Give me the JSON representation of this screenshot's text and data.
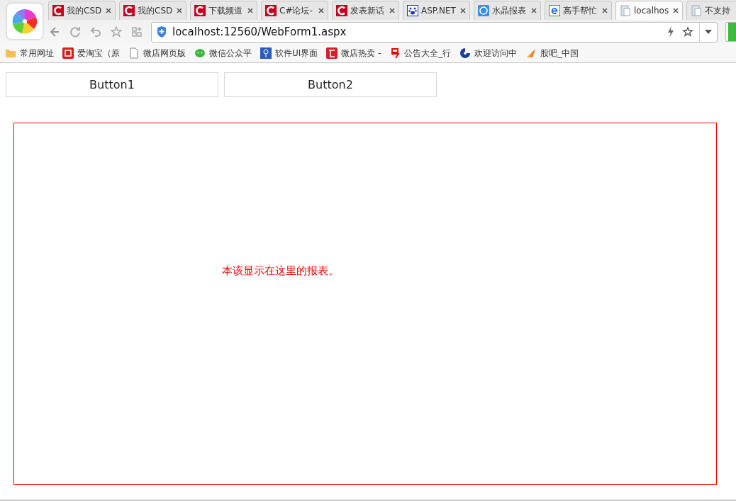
{
  "tabs": [
    {
      "kind": "csdn",
      "label": "我的CSD",
      "selected": false
    },
    {
      "kind": "csdn",
      "label": "我的CSD",
      "selected": false
    },
    {
      "kind": "csdn",
      "label": "下载频道",
      "selected": false
    },
    {
      "kind": "csdn",
      "label": "C#论坛-",
      "selected": false
    },
    {
      "kind": "csdn",
      "label": "发表新话",
      "selected": false
    },
    {
      "kind": "paw",
      "label": "ASP.NET",
      "selected": false
    },
    {
      "kind": "crystal",
      "label": "水晶报表",
      "selected": false
    },
    {
      "kind": "e",
      "label": "高手帮忙",
      "selected": false
    },
    {
      "kind": "doc",
      "label": "localhos",
      "selected": true
    },
    {
      "kind": "doc",
      "label": "不支持",
      "selected": false
    }
  ],
  "address_bar": {
    "value": "localhost:12560/WebForm1.aspx"
  },
  "bookmarks": [
    {
      "kind": "folder",
      "label": "常用网址"
    },
    {
      "kind": "tao",
      "label": "爱淘宝（原"
    },
    {
      "kind": "page",
      "label": "微店网页版"
    },
    {
      "kind": "wechat",
      "label": "微信公众平"
    },
    {
      "kind": "bulb",
      "label": "软件UI界面"
    },
    {
      "kind": "shop",
      "label": "微店热卖 -"
    },
    {
      "kind": "yi",
      "label": "公告大全_行"
    },
    {
      "kind": "bank",
      "label": "欢迎访问中"
    },
    {
      "kind": "flame",
      "label": "股吧_中国"
    }
  ],
  "page": {
    "buttons": [
      "Button1",
      "Button2"
    ],
    "report_message": "本该显示在这里的报表。"
  }
}
